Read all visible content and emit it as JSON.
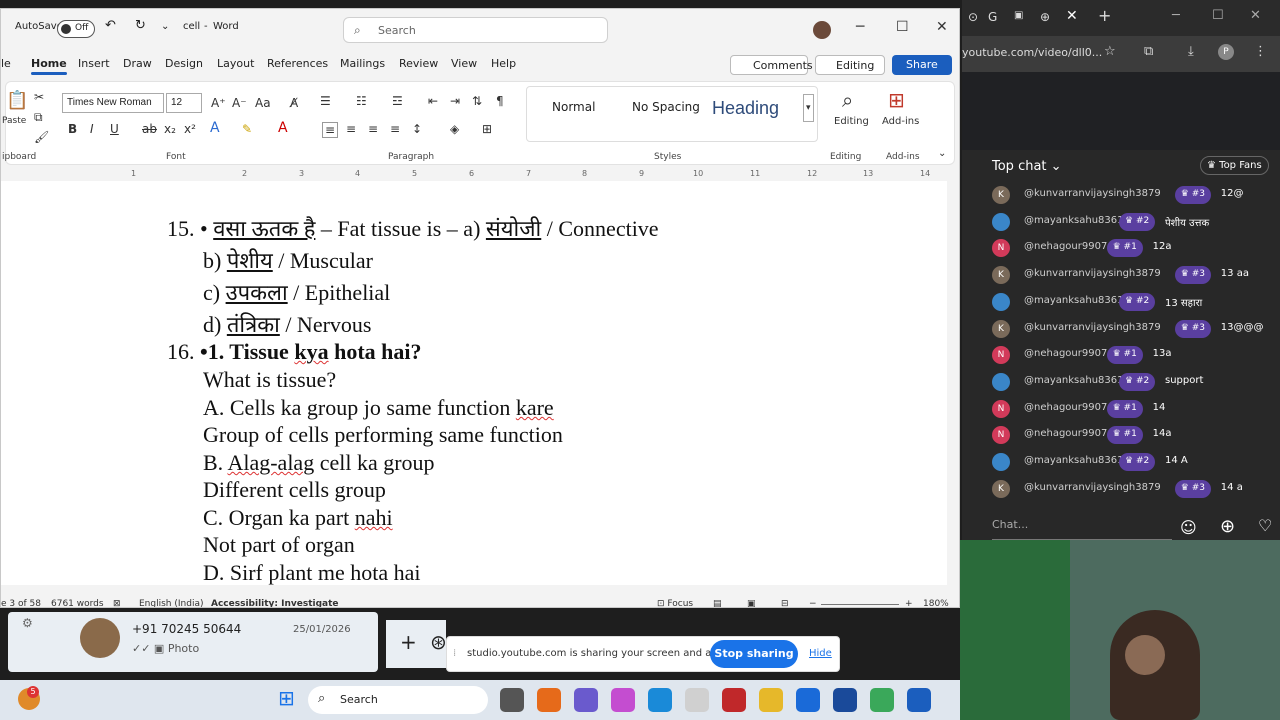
{
  "titlebar": {
    "autosave": "AutoSave",
    "toggle": "Off",
    "doc_title": "cell",
    "app_name": "Word",
    "search_placeholder": "Search"
  },
  "tabs": [
    "le",
    "Home",
    "Insert",
    "Draw",
    "Design",
    "Layout",
    "References",
    "Mailings",
    "Review",
    "View",
    "Help"
  ],
  "tab_actions": {
    "comments": "Comments",
    "editing": "Editing",
    "share": "Share"
  },
  "ribbon": {
    "font_name": "Times New Roman",
    "font_size": "12",
    "styles": {
      "normal": "Normal",
      "no_spacing": "No Spacing",
      "heading": "Heading"
    },
    "editing": "Editing",
    "addins": "Add-ins",
    "paste": "Paste",
    "groups": {
      "clipboard": "ipboard",
      "font": "Font",
      "paragraph": "Paragraph",
      "styles": "Styles",
      "editing": "Editing",
      "addins": "Add-ins"
    }
  },
  "ruler": [
    "1",
    "2",
    "3",
    "4",
    "5",
    "6",
    "7",
    "8",
    "9",
    "10",
    "11",
    "12",
    "13",
    "14"
  ],
  "document": {
    "q15_num": "15.",
    "q15_a": "•",
    "q15_b": "वसा ऊतक है",
    "q15_c": " – Fat tissue is – a) ",
    "q15_d": "संयोजी",
    "q15_e": " / Connective",
    "q15_opt_b_hi": "पेशीय",
    "q15_opt_b": " / Muscular",
    "q15_opt_c_hi": "उपकला",
    "q15_opt_c": " / Epithelial",
    "q15_opt_d_hi": "तंत्रिका",
    "q15_opt_d": " / Nervous",
    "q16_num": "16.",
    "q16_title_a": "•1. Tissue ",
    "q16_title_b": "kya",
    "q16_title_c": " hota hai?",
    "q16_en": "What is tissue?",
    "optA_a": "A. Cells ka group jo same function ",
    "optA_b": "kare",
    "optA_en": "Group of cells performing same function",
    "optB_a": "B. ",
    "optB_b": "Alag-alag",
    "optB_c": " cell ka group",
    "optB_en": "Different cells group",
    "optC_a": "C. Organ ka part ",
    "optC_b": "nahi",
    "optC_en": "Not part of organ",
    "optD": "D. Sirf plant me hota hai"
  },
  "status": {
    "page": "e 3 of 58",
    "words": "6761 words",
    "language": "English (India)",
    "accessibility": "Accessibility: Investigate",
    "focus": "Focus",
    "zoom": "180%"
  },
  "chrome": {
    "url": "youtube.com/video/dll0..."
  },
  "chat": {
    "header": "Top chat",
    "top_fans": "Top Fans",
    "placeholder": "Chat...",
    "messages": [
      {
        "initial": "K",
        "color": "#7a6a5a",
        "name": "@kunvarranvijaysingh3879",
        "badge": "#3",
        "text": "12@"
      },
      {
        "initial": "",
        "color": "#3a86c8",
        "name": "@mayanksahu8361",
        "badge": "#2",
        "text": "पेशीय उत्तक"
      },
      {
        "initial": "N",
        "color": "#d23a5a",
        "name": "@nehagour9907",
        "badge": "#1",
        "text": "12a"
      },
      {
        "initial": "K",
        "color": "#7a6a5a",
        "name": "@kunvarranvijaysingh3879",
        "badge": "#3",
        "text": "13 aa"
      },
      {
        "initial": "",
        "color": "#3a86c8",
        "name": "@mayanksahu8361",
        "badge": "#2",
        "text": "13 सहारा"
      },
      {
        "initial": "K",
        "color": "#7a6a5a",
        "name": "@kunvarranvijaysingh3879",
        "badge": "#3",
        "text": "13@@@"
      },
      {
        "initial": "N",
        "color": "#d23a5a",
        "name": "@nehagour9907",
        "badge": "#1",
        "text": "13a"
      },
      {
        "initial": "",
        "color": "#3a86c8",
        "name": "@mayanksahu8361",
        "badge": "#2",
        "text": "support"
      },
      {
        "initial": "N",
        "color": "#d23a5a",
        "name": "@nehagour9907",
        "badge": "#1",
        "text": "14"
      },
      {
        "initial": "N",
        "color": "#d23a5a",
        "name": "@nehagour9907",
        "badge": "#1",
        "text": "14a"
      },
      {
        "initial": "",
        "color": "#3a86c8",
        "name": "@mayanksahu8361",
        "badge": "#2",
        "text": "14 A"
      },
      {
        "initial": "K",
        "color": "#7a6a5a",
        "name": "@kunvarranvijaysingh3879",
        "badge": "#3",
        "text": "14 a"
      }
    ]
  },
  "whatsapp": {
    "contact": "+91 70245 50644",
    "date": "25/01/2026",
    "preview": "Photo"
  },
  "share_bar": {
    "message": "studio.youtube.com is sharing your screen and audio.",
    "stop": "Stop sharing",
    "hide": "Hide"
  },
  "taskbar": {
    "search": "Search",
    "badge": "5"
  },
  "colors": {
    "word_blue": "#1b5ebe",
    "badge_purple": "#5a3fa0",
    "stop_blue": "#1a73e8"
  }
}
